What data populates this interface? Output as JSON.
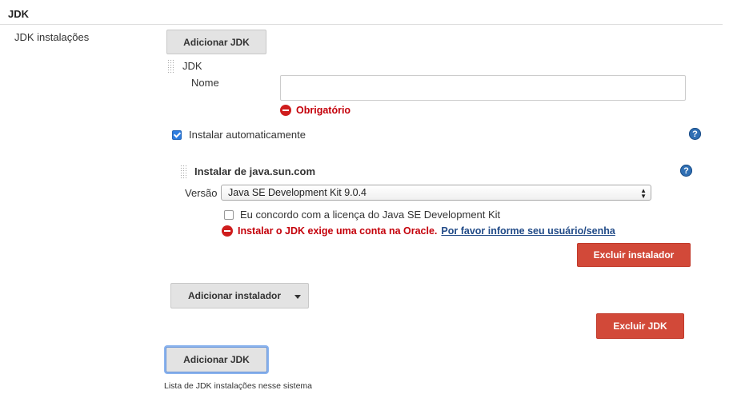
{
  "section": {
    "title": "JDK"
  },
  "jdk_installations": {
    "label": "JDK instalações",
    "add_jdk_label": "Adicionar JDK",
    "description": "Lista de JDK instalações nesse sistema"
  },
  "jdk_block": {
    "header": "JDK",
    "name_label": "Nome",
    "name_value": "",
    "name_error": "Obrigatório",
    "auto_install_label": "Instalar automaticamente",
    "auto_install_checked": true,
    "help_icon": "question-icon",
    "delete_jdk_label": "Excluir JDK"
  },
  "installer": {
    "title": "Instalar de java.sun.com",
    "version_label": "Versão",
    "version_selected": "Java SE Development Kit 9.0.4",
    "license_label": "Eu concordo com a licença do Java SE Development Kit",
    "license_checked": false,
    "error_text": "Instalar o JDK exige uma conta na Oracle.",
    "error_link": "Por favor informe seu usuário/senha",
    "delete_installer_label": "Excluir instalador",
    "add_installer_label": "Adicionar instalador"
  },
  "colors": {
    "danger": "#d24939",
    "error_text": "#c4000a",
    "help": "#2f6fb4",
    "link": "#204a87"
  }
}
